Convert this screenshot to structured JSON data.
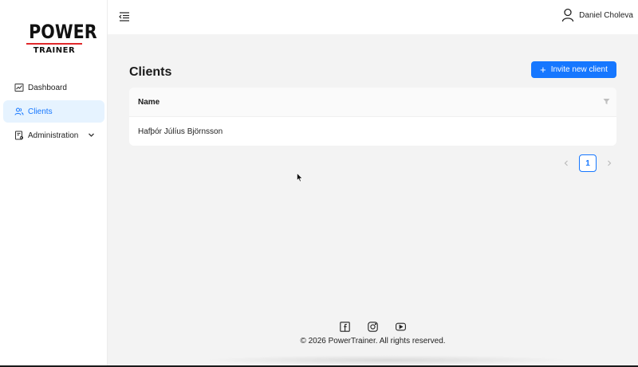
{
  "brand": {
    "line1": "POWER",
    "line2": "TRAINER",
    "accent": "#e0282a"
  },
  "sidebar": {
    "items": [
      {
        "label": "Dashboard",
        "icon": "chart-icon",
        "active": false
      },
      {
        "label": "Clients",
        "icon": "users-icon",
        "active": true
      },
      {
        "label": "Administration",
        "icon": "admin-icon",
        "active": false,
        "expandable": true
      }
    ]
  },
  "header": {
    "user_name": "Daniel Choleva"
  },
  "main": {
    "title": "Clients",
    "invite_label": "Invite new client",
    "table": {
      "columns": [
        "Name"
      ],
      "rows": [
        [
          "Hafþór Júlíus Björnsson"
        ]
      ]
    },
    "pagination": {
      "current_page": "1"
    }
  },
  "footer": {
    "copyright": "© 2026 PowerTrainer. All rights reserved.",
    "socials": [
      "facebook-icon",
      "instagram-icon",
      "youtube-icon"
    ]
  },
  "colors": {
    "primary": "#1677ff",
    "active_bg": "#e6f3ff"
  }
}
